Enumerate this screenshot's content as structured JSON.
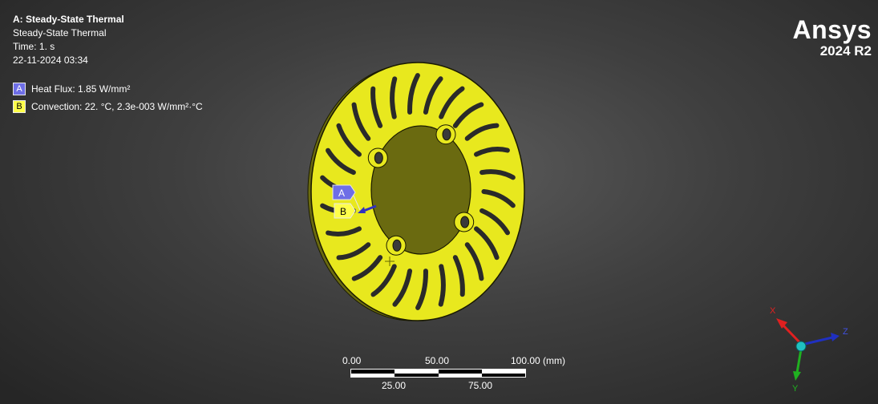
{
  "analysis": {
    "title": "A: Steady-State Thermal",
    "type": "Steady-State Thermal",
    "time": "Time: 1. s",
    "date": "22-11-2024 03:34"
  },
  "legend": {
    "items": [
      {
        "letter": "A",
        "label": "Heat Flux: 1.85 W/mm²",
        "color": "#6e6ee6"
      },
      {
        "letter": "B",
        "label": "Convection: 22. °C, 2.3e-003 W/mm²·°C",
        "color": "#ffff4a"
      }
    ]
  },
  "brand": {
    "name": "Ansys",
    "version": "2024 R2"
  },
  "model": {
    "part": "brake-disc",
    "face_color": "#e8e81e",
    "edge_color": "#1a1a00",
    "tags": [
      {
        "letter": "A"
      },
      {
        "letter": "B"
      }
    ]
  },
  "scale_bar": {
    "top_labels": [
      "0.00",
      "50.00",
      "100.00 (mm)"
    ],
    "bottom_labels": [
      "25.00",
      "75.00"
    ]
  },
  "triad": {
    "x": "X",
    "y": "Y",
    "z": "Z",
    "x_color": "#e02020",
    "y_color": "#20b020",
    "z_color": "#2030c0"
  }
}
